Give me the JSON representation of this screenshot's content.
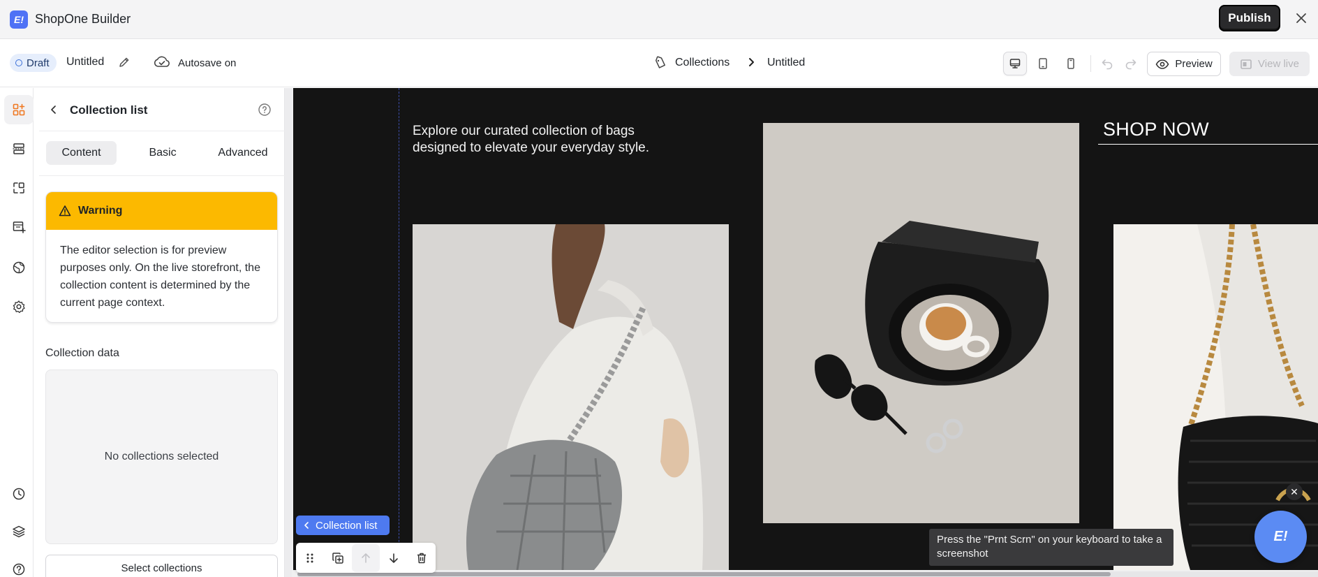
{
  "app": {
    "title": "ShopOne Builder",
    "logo_text": "E!",
    "brand_color": "#4f72f5"
  },
  "titlebar": {
    "publish_label": "Publish"
  },
  "toolbar": {
    "status_label": "Draft",
    "page_name": "Untitled",
    "autosave_label": "Autosave on",
    "breadcrumb": {
      "parent": "Collections",
      "current": "Untitled"
    },
    "device_modes": [
      {
        "icon": "desktop-icon",
        "active": true
      },
      {
        "icon": "tablet-icon",
        "active": false
      },
      {
        "icon": "mobile-icon",
        "active": false
      }
    ],
    "preview_label": "Preview",
    "view_live_label": "View live"
  },
  "rail": {
    "items": [
      {
        "icon": "add-elements-icon",
        "active": true
      },
      {
        "icon": "sections-icon",
        "active": false
      },
      {
        "icon": "components-icon",
        "active": false
      },
      {
        "icon": "page-add-icon",
        "active": false
      },
      {
        "icon": "globe-icon",
        "active": false
      },
      {
        "icon": "settings-icon",
        "active": false
      }
    ],
    "bottom_items": [
      "history-icon",
      "layers-icon",
      "help-icon"
    ]
  },
  "panel": {
    "title": "Collection list",
    "tabs": [
      {
        "label": "Content",
        "active": true
      },
      {
        "label": "Basic",
        "active": false
      },
      {
        "label": "Advanced",
        "active": false
      }
    ],
    "warning": {
      "title": "Warning",
      "body": "The editor selection is for preview purposes only. On the live storefront, the collection content is determined by the current page context.",
      "color": "#fcb900"
    },
    "collection_data_label": "Collection data",
    "empty_text": "No collections selected",
    "select_button_label": "Select collections"
  },
  "canvas": {
    "intro_text": "Explore our curated collection of bags designed to elevate your everyday style.",
    "cta_text": "SHOP NOW",
    "selected_element_label": "Collection list",
    "background": "#141414"
  },
  "tooltip": {
    "text": "Press the \"Prnt Scrn\" on your keyboard to take a screenshot"
  },
  "fab": {
    "label": "E!",
    "close_label": "✕"
  }
}
